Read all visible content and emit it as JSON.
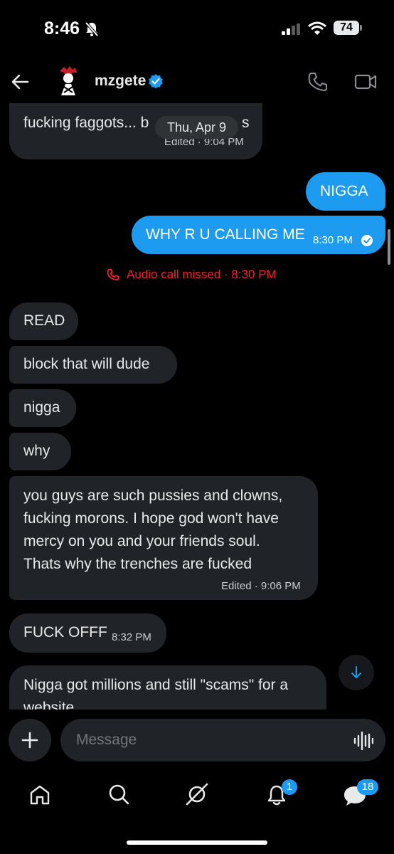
{
  "status_bar": {
    "time": "8:46",
    "battery": "74"
  },
  "header": {
    "username": "mzgete"
  },
  "messages": {
    "m1_text": "fucking faggots... b",
    "m1_tail": "s",
    "m1_meta": "Edited · 9:04 PM",
    "date_pill": "Thu, Apr 9",
    "m2_text": "NIGGA",
    "m3_text": "WHY R U CALLING ME",
    "m3_time": "8:30 PM",
    "missed_call": "Audio call missed · 8:30 PM",
    "m4_text": "READ",
    "m5_text": "block that will dude",
    "m6_text": "nigga",
    "m7_text": "why",
    "m8_line1": "you guys are such pussies and clowns,",
    "m8_line2": "fucking morons.  I hope god won't have",
    "m8_line3": "mercy on you and your friends soul.",
    "m8_line4": "Thats why the trenches are fucked",
    "m8_meta": "Edited · 9:06 PM",
    "m9_text": "FUCK OFFF",
    "m9_time": "8:32 PM",
    "m10_line1": "Nigga got millions and still \"scams\" for a",
    "m10_line2": "website"
  },
  "composer": {
    "placeholder": "Message"
  },
  "nav": {
    "notifications_badge": "1",
    "messages_badge": "18"
  },
  "colors": {
    "accent": "#1d9bf0",
    "bubble_in": "#202327",
    "missed": "#f4212e"
  }
}
